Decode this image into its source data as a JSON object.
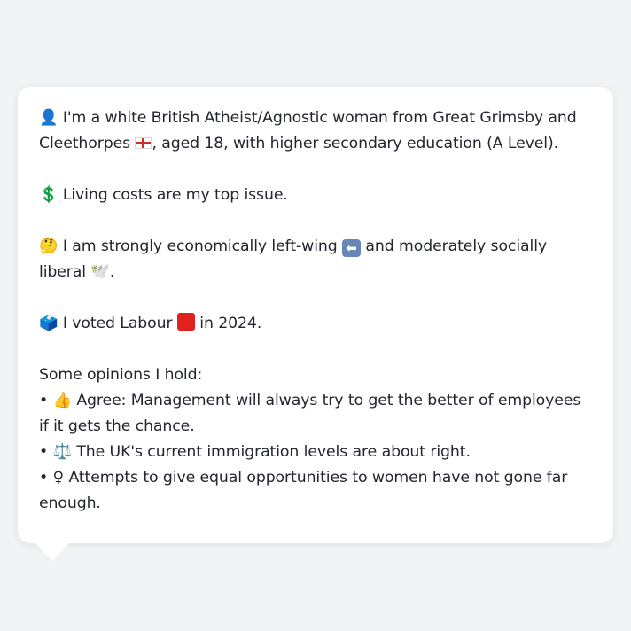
{
  "profile": {
    "intro": {
      "icon": "bust-silhouette-icon",
      "text_a": "I'm a white British Atheist/Agnostic woman from Great Grimsby and Cleethorpes ",
      "flag_icon": "england-flag-icon",
      "text_b": ", aged 18, with higher secondary education (A Level)."
    },
    "top_issue": {
      "icon": "dollar-sign-icon",
      "text": "Living costs are my top issue."
    },
    "ideology": {
      "icon": "thinking-face-icon",
      "text_a": "I am strongly economically left-wing ",
      "arrow_icon": "left-arrow-icon",
      "text_b": " and moderately socially liberal ",
      "dove_icon": "dove-icon",
      "text_c": "."
    },
    "vote": {
      "icon": "ballot-box-icon",
      "text_a": "I voted Labour ",
      "party_icon": "red-square-icon",
      "party_color": "#e0221f",
      "text_b": " in 2024."
    },
    "opinions_heading": "Some opinions I hold:",
    "opinions": [
      {
        "bullet": "•",
        "icon": "thumbs-up-icon",
        "text": "Agree: Management will always try to get the better of employees if it gets the chance."
      },
      {
        "bullet": "•",
        "icon": "balance-scale-icon",
        "text": "The UK's current immigration levels are about right."
      },
      {
        "bullet": "•",
        "icon": "female-sign-icon",
        "text": "Attempts to give equal opportunities to women have not gone far enough."
      }
    ]
  },
  "colors": {
    "background": "#f2f3f5",
    "bubble": "#ffffff",
    "text": "#23262d"
  }
}
